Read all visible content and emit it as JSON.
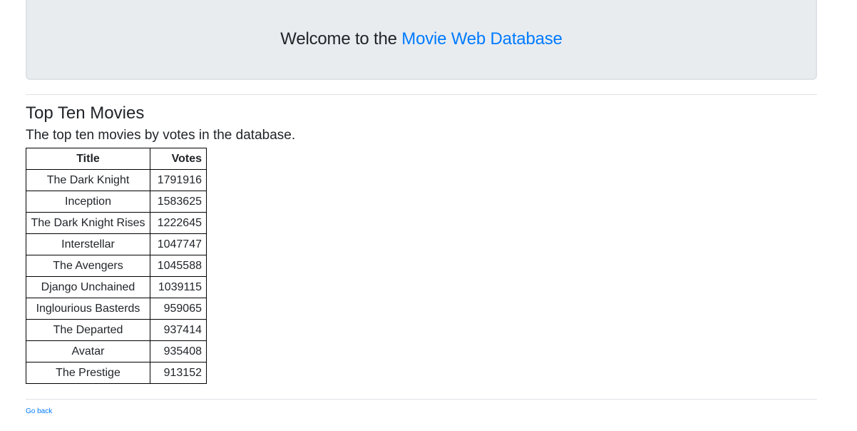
{
  "header": {
    "welcome_prefix": "Welcome to the ",
    "site_name": "Movie Web Database"
  },
  "section": {
    "title": "Top Ten Movies",
    "subtitle": "The top ten movies by votes in the database."
  },
  "table": {
    "columns": [
      "Title",
      "Votes"
    ],
    "rows": [
      {
        "title": "The Dark Knight",
        "votes": "1791916"
      },
      {
        "title": "Inception",
        "votes": "1583625"
      },
      {
        "title": "The Dark Knight Rises",
        "votes": "1222645"
      },
      {
        "title": "Interstellar",
        "votes": "1047747"
      },
      {
        "title": "The Avengers",
        "votes": "1045588"
      },
      {
        "title": "Django Unchained",
        "votes": "1039115"
      },
      {
        "title": "Inglourious Basterds",
        "votes": "959065"
      },
      {
        "title": "The Departed",
        "votes": "937414"
      },
      {
        "title": "Avatar",
        "votes": "935408"
      },
      {
        "title": "The Prestige",
        "votes": "913152"
      }
    ]
  },
  "footer": {
    "back_link": "Go back"
  },
  "colors": {
    "link": "#007bff",
    "jumbotron_bg": "#e9ecef"
  }
}
